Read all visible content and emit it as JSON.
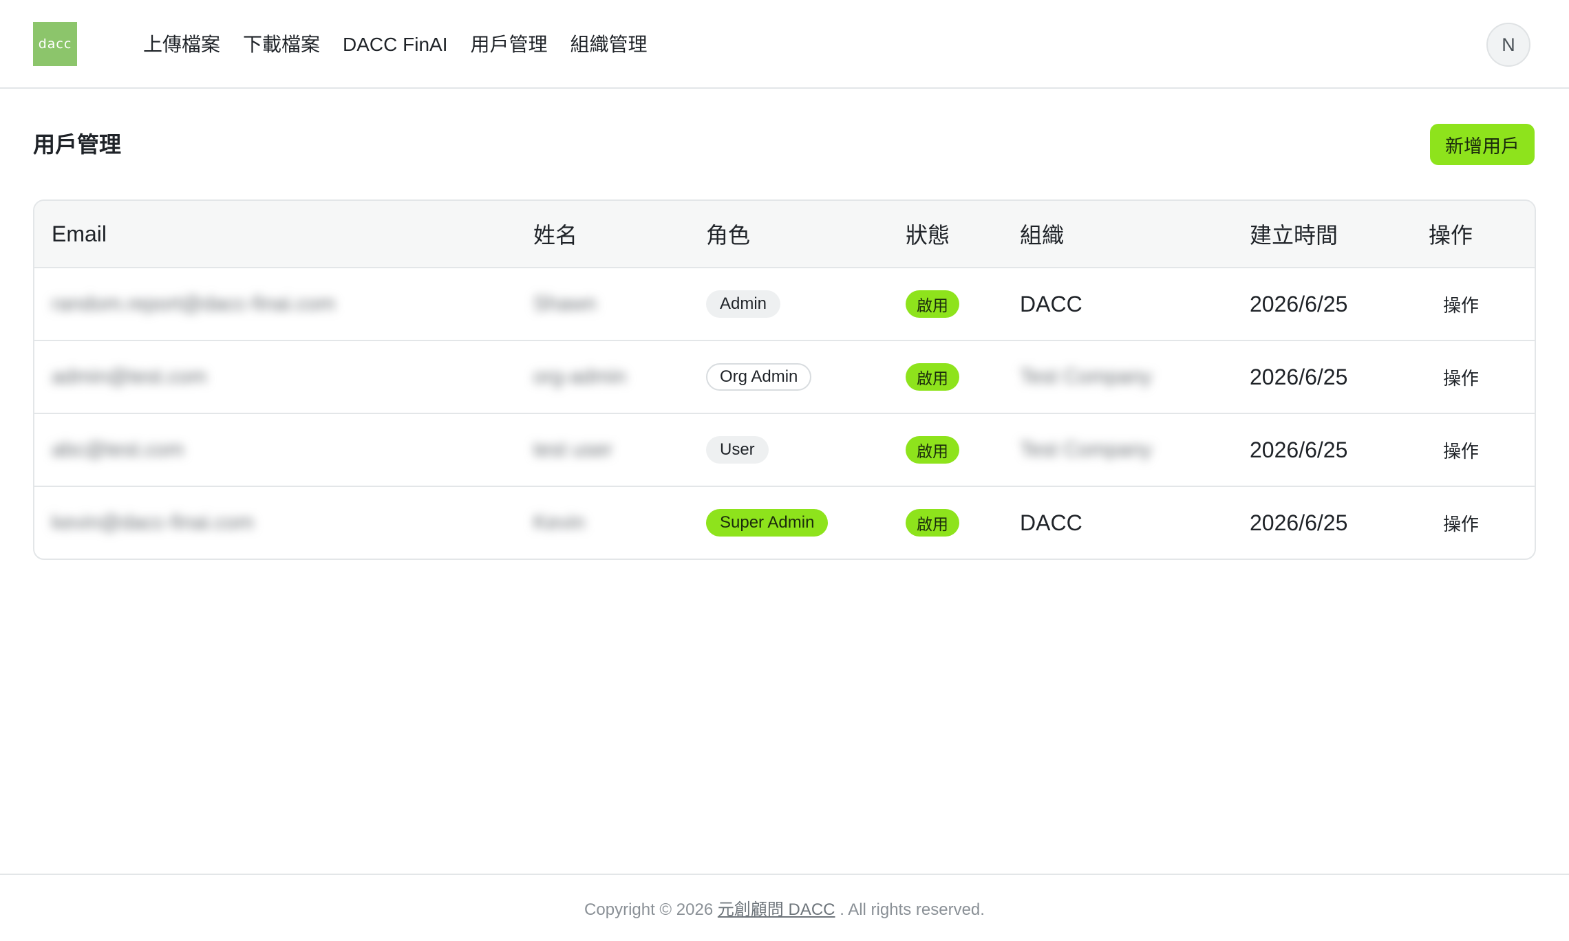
{
  "header": {
    "logo_text": "dacc",
    "nav": [
      {
        "label": "上傳檔案"
      },
      {
        "label": "下載檔案"
      },
      {
        "label": "DACC FinAI"
      },
      {
        "label": "用戶管理"
      },
      {
        "label": "組織管理"
      }
    ],
    "avatar_initial": "N"
  },
  "page": {
    "title": "用戶管理",
    "add_button": "新增用戶"
  },
  "table": {
    "columns": {
      "email": "Email",
      "name": "姓名",
      "role": "角色",
      "status": "狀態",
      "org": "組織",
      "created": "建立時間",
      "actions": "操作"
    },
    "rows": [
      {
        "email": "random.report@dacc-finai.com",
        "name": "Shawn",
        "role": "Admin",
        "status": "啟用",
        "org": "DACC",
        "created": "2026/6/25",
        "action": "操作"
      },
      {
        "email": "admin@test.com",
        "name": "org-admin",
        "role": "Org Admin",
        "status": "啟用",
        "org": "Test Company",
        "created": "2026/6/25",
        "action": "操作"
      },
      {
        "email": "abc@test.com",
        "name": "test user",
        "role": "User",
        "status": "啟用",
        "org": "Test Company",
        "created": "2026/6/25",
        "action": "操作"
      },
      {
        "email": "kevin@dacc-finai.com",
        "name": "Kevin",
        "role": "Super Admin",
        "status": "啟用",
        "org": "DACC",
        "created": "2026/6/25",
        "action": "操作"
      }
    ]
  },
  "footer": {
    "prefix": "Copyright © 2026",
    "link": "元創顧問 DACC",
    "suffix": ". All rights reserved."
  },
  "colors": {
    "accent": "#8ee31c",
    "logo_bg": "#8cc56b",
    "border": "#e3e6e8",
    "header_row_bg": "#f6f7f7"
  }
}
